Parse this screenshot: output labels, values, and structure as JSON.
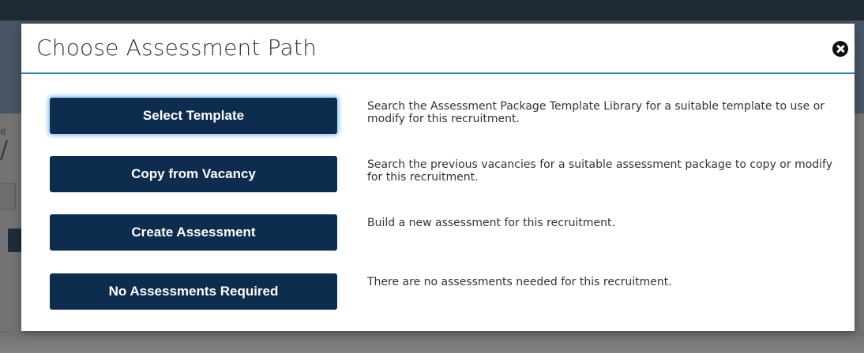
{
  "background": {
    "field_label": "e",
    "field_value": "/"
  },
  "modal": {
    "title": "Choose Assessment Path",
    "close_icon": "close-circle-icon",
    "accent_color": "#2a7fae",
    "button_color": "#0e2c4e",
    "options": [
      {
        "button_label": "Select Template",
        "description": "Search the Assessment Package Template Library for a suitable template to use or modify for this recruitment."
      },
      {
        "button_label": "Copy from Vacancy",
        "description": "Search the previous vacancies for a suitable assessment package to copy or modify for this recruitment."
      },
      {
        "button_label": "Create Assessment",
        "description": "Build a new assessment for this recruitment."
      },
      {
        "button_label": "No Assessments Required",
        "description": "There are no assessments needed for this recruitment."
      }
    ]
  }
}
